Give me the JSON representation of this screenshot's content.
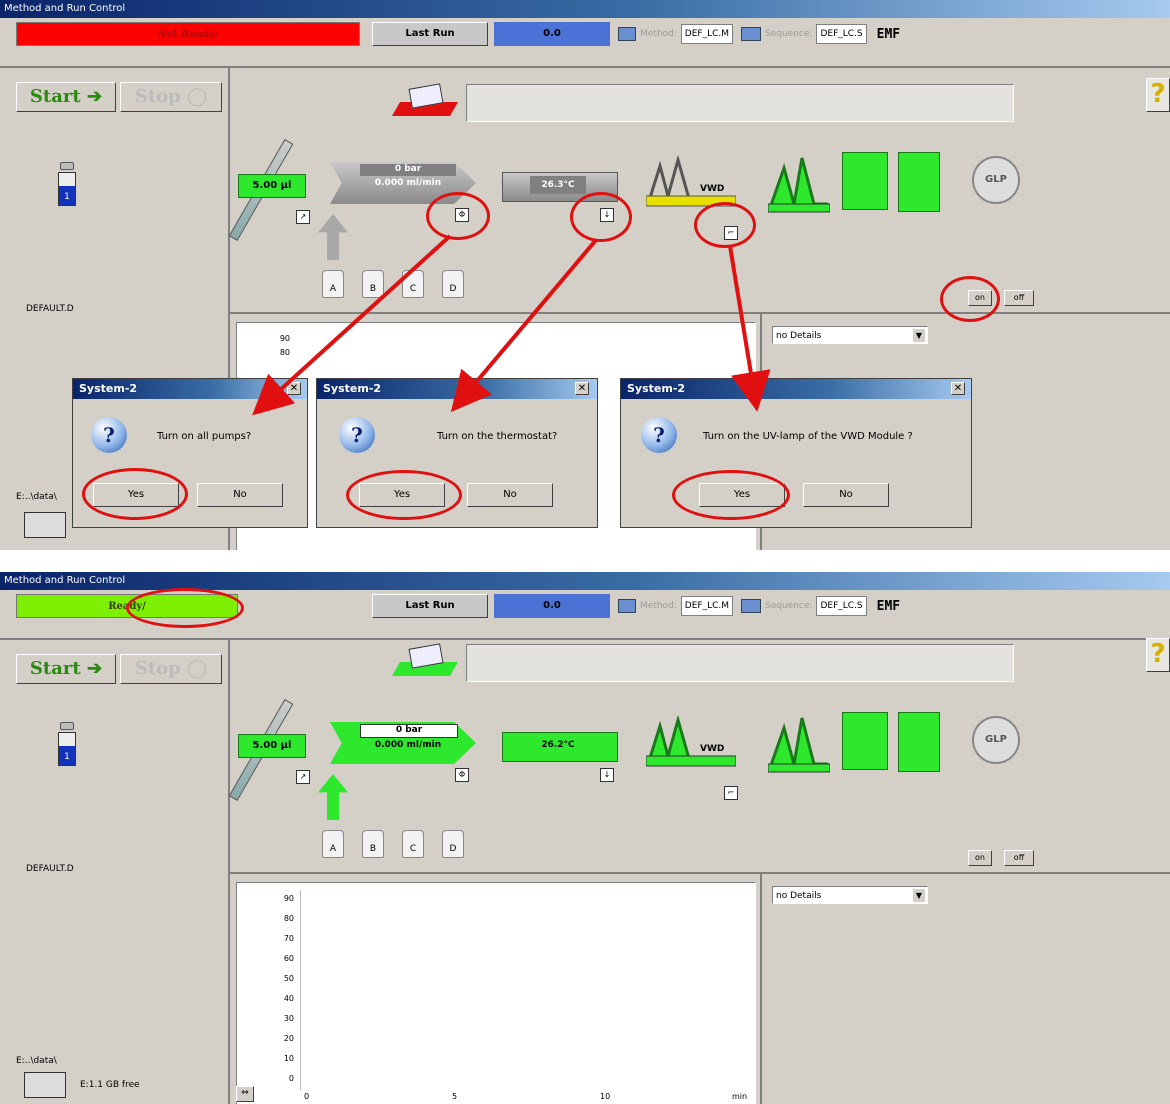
{
  "window_title": "Method and Run Control",
  "top_panel": {
    "status": "Not Ready/",
    "status_color": "#ff0000",
    "last_run_label": "Last Run",
    "run_value": "0.0",
    "method_label": "Method:",
    "method_value": "DEF_LC.M",
    "sequence_label": "Sequence:",
    "sequence_value": "DEF_LC.S",
    "emf_label": "EMF",
    "start_label": "Start",
    "stop_label": "Stop",
    "help_glyph": "?",
    "vial_number": "1",
    "data_file": "DEFAULT.D",
    "path": "E:..\\data\\",
    "injector_volume": "5.00 µl",
    "pump_pressure": "0 bar",
    "pump_flow": "0.000 ml/min",
    "thermostat_temp": "26.3°C",
    "vwd_label": "VWD",
    "glp_label": "GLP",
    "solvents": [
      "A",
      "B",
      "C",
      "D"
    ],
    "on_label": "on",
    "off_label": "off",
    "details_value": "no Details",
    "y_ticks": [
      "90",
      "80"
    ],
    "dialogs": [
      {
        "title": "System-2",
        "question": "Turn on all pumps?",
        "yes": "Yes",
        "no": "No",
        "close": "✕"
      },
      {
        "title": "System-2",
        "question": "Turn on the thermostat?",
        "yes": "Yes",
        "no": "No",
        "close": "✕"
      },
      {
        "title": "System-2",
        "question": "Turn on the UV-lamp of the VWD Module ?",
        "yes": "Yes",
        "no": "No",
        "close": "✕"
      }
    ]
  },
  "bottom_panel": {
    "status": "Ready/",
    "status_color": "#7cf000",
    "last_run_label": "Last Run",
    "run_value": "0.0",
    "method_label": "Method:",
    "method_value": "DEF_LC.M",
    "sequence_label": "Sequence:",
    "sequence_value": "DEF_LC.S",
    "emf_label": "EMF",
    "start_label": "Start",
    "stop_label": "Stop",
    "help_glyph": "?",
    "vial_number": "1",
    "data_file": "DEFAULT.D",
    "path": "E:..\\data\\",
    "disk_free": "E:1.1 GB free",
    "injector_volume": "5.00 µl",
    "pump_pressure": "0 bar",
    "pump_flow": "0.000 ml/min",
    "thermostat_temp": "26.2°C",
    "vwd_label": "VWD",
    "glp_label": "GLP",
    "solvents": [
      "A",
      "B",
      "C",
      "D"
    ],
    "on_label": "on",
    "off_label": "off",
    "details_value": "no Details",
    "y_ticks": [
      "90",
      "80",
      "70",
      "60",
      "50",
      "40",
      "30",
      "20",
      "10",
      "0"
    ],
    "x_ticks": [
      "0",
      "5",
      "10"
    ],
    "x_unit": "min"
  },
  "colors": {
    "green": "#2ee82e",
    "yellow": "#e8e000",
    "gray": "#a8a8a8",
    "annotation_red": "#e01010"
  }
}
